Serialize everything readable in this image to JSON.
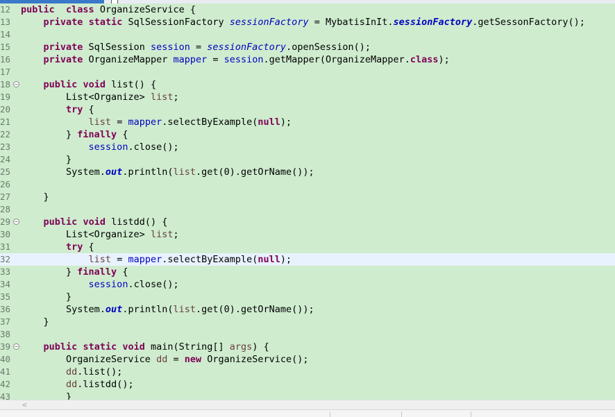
{
  "editor": {
    "lines": [
      {
        "n": "12",
        "fold": false,
        "hl": false,
        "t": [
          [
            "kw",
            "public"
          ],
          [
            "",
            "  "
          ],
          [
            "kw",
            "class"
          ],
          [
            "",
            " OrganizeService {"
          ]
        ]
      },
      {
        "n": "13",
        "fold": false,
        "hl": false,
        "t": [
          [
            "",
            "    "
          ],
          [
            "kw",
            "private"
          ],
          [
            "",
            " "
          ],
          [
            "kw",
            "static"
          ],
          [
            "",
            " SqlSessionFactory "
          ],
          [
            "fld ital",
            "sessionFactory"
          ],
          [
            "",
            " = MybatisInIt."
          ],
          [
            "sf",
            "sessionFactory"
          ],
          [
            "",
            ".getSessonFactory();"
          ]
        ]
      },
      {
        "n": "14",
        "fold": false,
        "hl": false,
        "t": []
      },
      {
        "n": "15",
        "fold": false,
        "hl": false,
        "t": [
          [
            "",
            "    "
          ],
          [
            "kw",
            "private"
          ],
          [
            "",
            " SqlSession "
          ],
          [
            "fld",
            "session"
          ],
          [
            "",
            " = "
          ],
          [
            "fld ital",
            "sessionFactory"
          ],
          [
            "",
            ".openSession();"
          ]
        ]
      },
      {
        "n": "16",
        "fold": false,
        "hl": false,
        "t": [
          [
            "",
            "    "
          ],
          [
            "kw",
            "private"
          ],
          [
            "",
            " OrganizeMapper "
          ],
          [
            "fld",
            "mapper"
          ],
          [
            "",
            " = "
          ],
          [
            "fld",
            "session"
          ],
          [
            "",
            ".getMapper(OrganizeMapper."
          ],
          [
            "kw",
            "class"
          ],
          [
            "",
            ");"
          ]
        ]
      },
      {
        "n": "17",
        "fold": false,
        "hl": false,
        "t": []
      },
      {
        "n": "18",
        "fold": true,
        "hl": false,
        "t": [
          [
            "",
            "    "
          ],
          [
            "kw",
            "public"
          ],
          [
            "",
            " "
          ],
          [
            "kw",
            "void"
          ],
          [
            "",
            " list() {"
          ]
        ]
      },
      {
        "n": "19",
        "fold": false,
        "hl": false,
        "t": [
          [
            "",
            "        List<Organize> "
          ],
          [
            "var",
            "list"
          ],
          [
            "",
            ";"
          ]
        ]
      },
      {
        "n": "20",
        "fold": false,
        "hl": false,
        "t": [
          [
            "",
            "        "
          ],
          [
            "kw",
            "try"
          ],
          [
            "",
            " {"
          ]
        ]
      },
      {
        "n": "21",
        "fold": false,
        "hl": false,
        "t": [
          [
            "",
            "            "
          ],
          [
            "var",
            "list"
          ],
          [
            "",
            " = "
          ],
          [
            "fld",
            "mapper"
          ],
          [
            "",
            ".selectByExample("
          ],
          [
            "kw",
            "null"
          ],
          [
            "",
            ");"
          ]
        ]
      },
      {
        "n": "22",
        "fold": false,
        "hl": false,
        "t": [
          [
            "",
            "        } "
          ],
          [
            "kw",
            "finally"
          ],
          [
            "",
            " {"
          ]
        ]
      },
      {
        "n": "23",
        "fold": false,
        "hl": false,
        "t": [
          [
            "",
            "            "
          ],
          [
            "fld",
            "session"
          ],
          [
            "",
            ".close();"
          ]
        ]
      },
      {
        "n": "24",
        "fold": false,
        "hl": false,
        "t": [
          [
            "",
            "        }"
          ]
        ]
      },
      {
        "n": "25",
        "fold": false,
        "hl": false,
        "t": [
          [
            "",
            "        System."
          ],
          [
            "sf",
            "out"
          ],
          [
            "",
            ".println("
          ],
          [
            "var",
            "list"
          ],
          [
            "",
            ".get(0).getOrName());"
          ]
        ]
      },
      {
        "n": "26",
        "fold": false,
        "hl": false,
        "t": []
      },
      {
        "n": "27",
        "fold": false,
        "hl": false,
        "t": [
          [
            "",
            "    }"
          ]
        ]
      },
      {
        "n": "28",
        "fold": false,
        "hl": false,
        "t": []
      },
      {
        "n": "29",
        "fold": true,
        "hl": false,
        "t": [
          [
            "",
            "    "
          ],
          [
            "kw",
            "public"
          ],
          [
            "",
            " "
          ],
          [
            "kw",
            "void"
          ],
          [
            "",
            " listdd() {"
          ]
        ]
      },
      {
        "n": "30",
        "fold": false,
        "hl": false,
        "t": [
          [
            "",
            "        List<Organize> "
          ],
          [
            "var",
            "list"
          ],
          [
            "",
            ";"
          ]
        ]
      },
      {
        "n": "31",
        "fold": false,
        "hl": false,
        "t": [
          [
            "",
            "        "
          ],
          [
            "kw",
            "try"
          ],
          [
            "",
            " {"
          ]
        ]
      },
      {
        "n": "32",
        "fold": false,
        "hl": true,
        "t": [
          [
            "",
            "            "
          ],
          [
            "var",
            "list"
          ],
          [
            "",
            " = "
          ],
          [
            "fld",
            "mapper"
          ],
          [
            "",
            ".selectByExample("
          ],
          [
            "kw",
            "null"
          ],
          [
            "",
            ");"
          ]
        ]
      },
      {
        "n": "33",
        "fold": false,
        "hl": false,
        "t": [
          [
            "",
            "        } "
          ],
          [
            "kw",
            "finally"
          ],
          [
            "",
            " {"
          ]
        ]
      },
      {
        "n": "34",
        "fold": false,
        "hl": false,
        "t": [
          [
            "",
            "            "
          ],
          [
            "fld",
            "session"
          ],
          [
            "",
            ".close();"
          ]
        ]
      },
      {
        "n": "35",
        "fold": false,
        "hl": false,
        "t": [
          [
            "",
            "        }"
          ]
        ]
      },
      {
        "n": "36",
        "fold": false,
        "hl": false,
        "t": [
          [
            "",
            "        System."
          ],
          [
            "sf",
            "out"
          ],
          [
            "",
            ".println("
          ],
          [
            "var",
            "list"
          ],
          [
            "",
            ".get(0).getOrName());"
          ]
        ]
      },
      {
        "n": "37",
        "fold": false,
        "hl": false,
        "t": [
          [
            "",
            "    }"
          ]
        ]
      },
      {
        "n": "38",
        "fold": false,
        "hl": false,
        "t": []
      },
      {
        "n": "39",
        "fold": true,
        "hl": false,
        "t": [
          [
            "",
            "    "
          ],
          [
            "kw",
            "public"
          ],
          [
            "",
            " "
          ],
          [
            "kw",
            "static"
          ],
          [
            "",
            " "
          ],
          [
            "kw",
            "void"
          ],
          [
            "",
            " main(String[] "
          ],
          [
            "var",
            "args"
          ],
          [
            "",
            ") {"
          ]
        ]
      },
      {
        "n": "40",
        "fold": false,
        "hl": false,
        "t": [
          [
            "",
            "        OrganizeService "
          ],
          [
            "var",
            "dd"
          ],
          [
            "",
            " = "
          ],
          [
            "kw",
            "new"
          ],
          [
            "",
            " OrganizeService();"
          ]
        ]
      },
      {
        "n": "41",
        "fold": false,
        "hl": false,
        "t": [
          [
            "",
            "        "
          ],
          [
            "var",
            "dd"
          ],
          [
            "",
            ".list();"
          ]
        ]
      },
      {
        "n": "42",
        "fold": false,
        "hl": false,
        "t": [
          [
            "",
            "        "
          ],
          [
            "var",
            "dd"
          ],
          [
            "",
            ".listdd();"
          ]
        ]
      },
      {
        "n": "43",
        "fold": false,
        "hl": false,
        "t": [
          [
            "",
            "        }"
          ]
        ]
      }
    ]
  },
  "scrollbar": {
    "left_arrow": "<"
  },
  "colors": {
    "editor_bg": "#cfeccf",
    "keyword": "#7f0055",
    "field": "#0000c0",
    "local_var": "#6a3e3e",
    "current_line": "#e8f2fe"
  }
}
